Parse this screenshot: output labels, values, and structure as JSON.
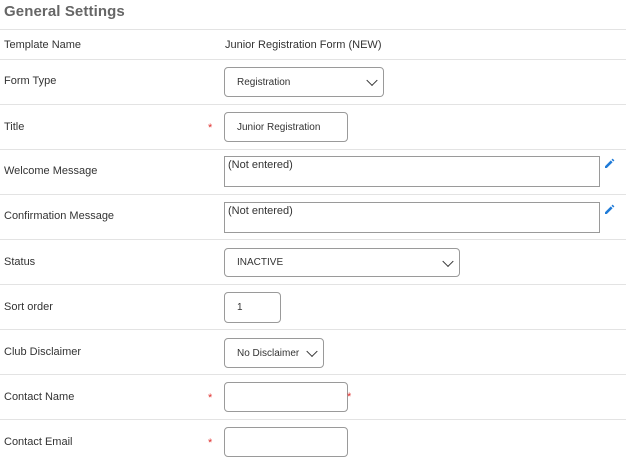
{
  "section_title": "General Settings",
  "template_name": {
    "label": "Template Name",
    "value": "Junior Registration Form (NEW)"
  },
  "form_type": {
    "label": "Form Type",
    "selected": "Registration"
  },
  "title_field": {
    "label": "Title",
    "required_mark": "*",
    "value": "Junior Registration"
  },
  "welcome_message": {
    "label": "Welcome Message",
    "value": "(Not entered)",
    "edit_icon": "pencil-icon"
  },
  "confirmation_message": {
    "label": "Confirmation Message",
    "value": "(Not entered)",
    "edit_icon": "pencil-icon"
  },
  "status": {
    "label": "Status",
    "selected": "INACTIVE"
  },
  "sort_order": {
    "label": "Sort order",
    "value": "1"
  },
  "club_disclaimer": {
    "label": "Club Disclaimer",
    "selected": "No Disclaimer"
  },
  "contact_name": {
    "label": "Contact Name",
    "required_mark": "*",
    "value": "",
    "trailing_mark": "*"
  },
  "contact_email": {
    "label": "Contact Email",
    "required_mark": "*",
    "value": ""
  },
  "colors": {
    "required": "#e0302e",
    "edit_icon": "#1f7bd8",
    "divider": "#e3e3e3"
  }
}
